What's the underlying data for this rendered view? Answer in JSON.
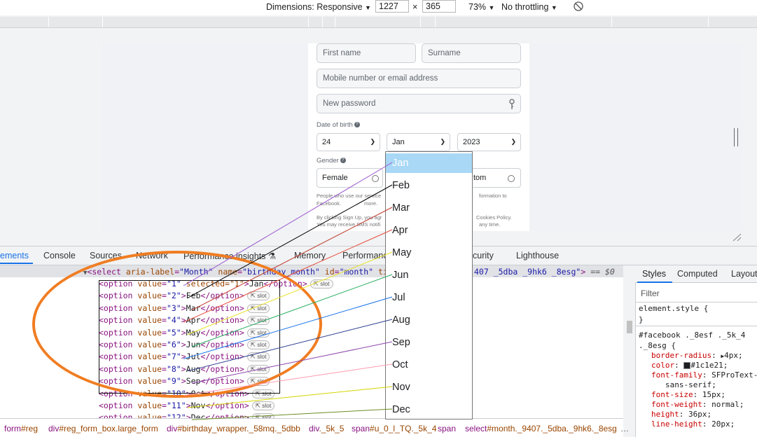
{
  "device_toolbar": {
    "dimensions_label": "Dimensions: Responsive",
    "width": "1227",
    "times": "×",
    "height": "365",
    "zoom": "73%",
    "throttling": "No throttling"
  },
  "form": {
    "first_name_placeholder": "First name",
    "surname_placeholder": "Surname",
    "mobile_placeholder": "Mobile number or email address",
    "password_placeholder": "New password",
    "dob_label": "Date of birth",
    "day": "24",
    "month": "Jan",
    "year": "2023",
    "gender_label": "Gender",
    "female": "Female",
    "custom": "tom",
    "small_text_1a": "People who use our service",
    "small_text_1b": "formation to",
    "small_text_2a": "Facebook.",
    "small_text_2b": "more.",
    "small_text_3a": "By clicking Sign Up, you agr",
    "small_text_3b": "Cookies Policy.",
    "small_text_4a": "You may receive SMS notifi",
    "small_text_4b": "any time."
  },
  "dropdown": {
    "options": [
      "Jan",
      "Feb",
      "Mar",
      "Apr",
      "May",
      "Jun",
      "Jul",
      "Aug",
      "Sep",
      "Oct",
      "Nov",
      "Dec"
    ]
  },
  "devtools_tabs": [
    "ements",
    "Console",
    "Sources",
    "Network",
    "Performance insights",
    "Memory",
    "Performance",
    "curity",
    "Lighthouse"
  ],
  "elements": {
    "select_open": "<select",
    "attr_aria_name": "aria-label",
    "attr_aria_val": "\"Month\"",
    "attr_name_name": "name",
    "attr_name_val": "\"birthday_month\"",
    "attr_id_name": "id",
    "attr_id_val": "\"month\"",
    "attr_title": "title",
    "tail_class": "407 _5dba _9hk6 _8esg\"",
    "tail_eq": "== $0",
    "slot_label": "slot",
    "options": [
      {
        "value": "1",
        "extra": " selected=\"1\"",
        "text": "Jan"
      },
      {
        "value": "2",
        "extra": "",
        "text": "Feb"
      },
      {
        "value": "3",
        "extra": "",
        "text": "Mar"
      },
      {
        "value": "4",
        "extra": "",
        "text": "Apr"
      },
      {
        "value": "5",
        "extra": "",
        "text": "May"
      },
      {
        "value": "6",
        "extra": "",
        "text": "Jun"
      },
      {
        "value": "7",
        "extra": "",
        "text": "Jul"
      },
      {
        "value": "8",
        "extra": "",
        "text": "Aug"
      },
      {
        "value": "9",
        "extra": "",
        "text": "Sep"
      },
      {
        "value": "10",
        "extra": "",
        "text": "Oct"
      },
      {
        "value": "11",
        "extra": "",
        "text": "Nov"
      },
      {
        "value": "12",
        "extra": "",
        "text": "Dec"
      }
    ]
  },
  "breadcrumb": [
    {
      "tag": "form",
      "cls": "#reg"
    },
    {
      "tag": "div",
      "cls": "#reg_form_box.large_form"
    },
    {
      "tag": "div",
      "cls": "#birthday_wrapper._58mq._5dbb"
    },
    {
      "tag": "div",
      "cls": "._5k_5"
    },
    {
      "tag": "span",
      "cls": "#u_0_l_TQ._5k_4"
    },
    {
      "tag": "span",
      "cls": ""
    },
    {
      "tag": "select",
      "cls": "#month._9407._5dba._9hk6._8esg"
    }
  ],
  "styles": {
    "tabs": [
      "Styles",
      "Computed",
      "Layout"
    ],
    "filter_placeholder": "Filter",
    "element_style": "element.style {",
    "close_brace": "}",
    "selector_1": "#facebook ._8esf ._5k_4",
    "selector_2": "._8esg {",
    "props": [
      {
        "name": "border-radius",
        "value": "4px;",
        "arrow": true
      },
      {
        "name": "color",
        "value": "#1c1e21;",
        "swatch": true
      },
      {
        "name": "font-family",
        "value": "SFProText-"
      },
      {
        "name": "",
        "value": "sans-serif;"
      },
      {
        "name": "font-size",
        "value": "15px;"
      },
      {
        "name": "font-weight",
        "value": "normal;"
      },
      {
        "name": "height",
        "value": "36px;"
      },
      {
        "name": "line-height",
        "value": "20px;"
      }
    ]
  },
  "colors": {
    "accent": "#1a73e8",
    "annotation_ellipse": "#f07d22",
    "dropdown_selected": "#a8d8f5"
  }
}
